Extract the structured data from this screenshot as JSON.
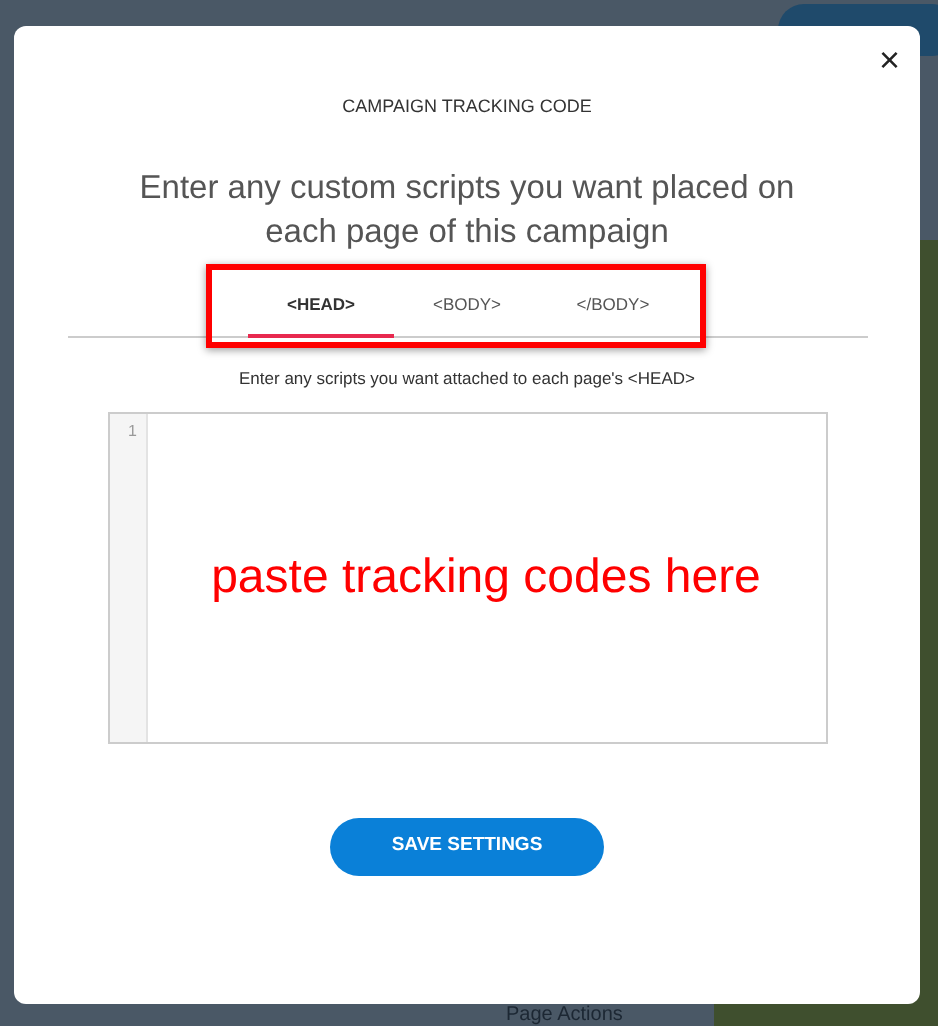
{
  "background": {
    "menu_label": "Page Actions"
  },
  "modal": {
    "close": "×",
    "title": "CAMPAIGN TRACKING CODE",
    "heading": "Enter any custom scripts you want placed on each page of this campaign",
    "tabs": [
      {
        "label": "<HEAD>",
        "selected": true
      },
      {
        "label": "<BODY>",
        "selected": false
      },
      {
        "label": "</BODY>",
        "selected": false
      }
    ],
    "tabs_highlighted": true,
    "description": "Enter any scripts you want attached to each page's <HEAD>",
    "editor": {
      "line_numbers": [
        "1"
      ],
      "annotation": "paste tracking codes here"
    },
    "button": "SAVE SETTINGS"
  }
}
